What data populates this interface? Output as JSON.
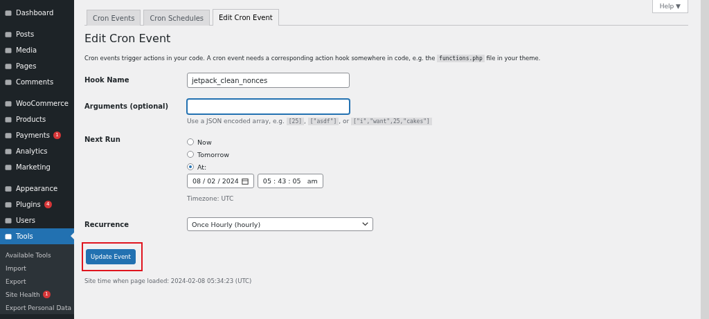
{
  "sidebar": {
    "groups": [
      {
        "items": [
          {
            "label": "Dashboard",
            "selected": false
          }
        ]
      },
      {
        "items": [
          {
            "label": "Posts",
            "selected": false
          },
          {
            "label": "Media",
            "selected": false
          },
          {
            "label": "Pages",
            "selected": false
          },
          {
            "label": "Comments",
            "selected": false
          }
        ]
      },
      {
        "items": [
          {
            "label": "WooCommerce",
            "selected": false
          },
          {
            "label": "Products",
            "selected": false
          },
          {
            "label": "Payments",
            "badge": "1",
            "selected": false
          },
          {
            "label": "Analytics",
            "selected": false
          },
          {
            "label": "Marketing",
            "selected": false
          }
        ]
      },
      {
        "items": [
          {
            "label": "Appearance",
            "selected": false
          },
          {
            "label": "Plugins",
            "badge": "4",
            "selected": false
          },
          {
            "label": "Users",
            "selected": false
          },
          {
            "label": "Tools",
            "selected": true
          }
        ]
      }
    ],
    "submenu": [
      {
        "label": "Available Tools"
      },
      {
        "label": "Import"
      },
      {
        "label": "Export"
      },
      {
        "label": "Site Health",
        "badge": "1"
      },
      {
        "label": "Export Personal Data"
      }
    ]
  },
  "help_button": "Help ▼",
  "tabs": [
    {
      "label": "Cron Events",
      "selected": false
    },
    {
      "label": "Cron Schedules",
      "selected": false
    },
    {
      "label": "Edit Cron Event",
      "selected": true
    }
  ],
  "heading": "Edit Cron Event",
  "description": [
    {
      "kind": "text",
      "text": "Cron events trigger actions in your code. A cron event needs a corresponding action hook somewhere in code, e.g. the "
    },
    {
      "kind": "code",
      "text": "functions.php"
    },
    {
      "kind": "text",
      "text": " file in your theme."
    }
  ],
  "form": {
    "hook_name": {
      "label": "Hook Name",
      "value": "jetpack_clean_nonces"
    },
    "arguments": {
      "label": "Arguments (optional)",
      "focused": true,
      "hint": [
        {
          "kind": "text",
          "text": "Use a JSON encoded array, e.g. "
        },
        {
          "kind": "code",
          "text": "[25]"
        },
        {
          "kind": "text",
          "text": ", "
        },
        {
          "kind": "code",
          "text": "[\"asdf\"]"
        },
        {
          "kind": "text",
          "text": ", or "
        },
        {
          "kind": "code",
          "text": "[\"i\",\"want\",25,\"cakes\"]"
        }
      ]
    },
    "next_run": {
      "label": "Next Run",
      "options": [
        {
          "label": "Now",
          "selected": false
        },
        {
          "label": "Tomorrow",
          "selected": false
        },
        {
          "label": "At:",
          "selected": true
        }
      ],
      "date": "08 / 02 / 2024",
      "time": "05 : 43 : 05   am",
      "timezone": "Timezone: UTC"
    },
    "recurrence": {
      "label": "Recurrence",
      "value": "Once Hourly (hourly)"
    }
  },
  "submit": {
    "label": "Update Event",
    "highlighted": true
  },
  "site_time": "Site time when page loaded: 2024-02-08 05:34:23 (UTC)"
}
